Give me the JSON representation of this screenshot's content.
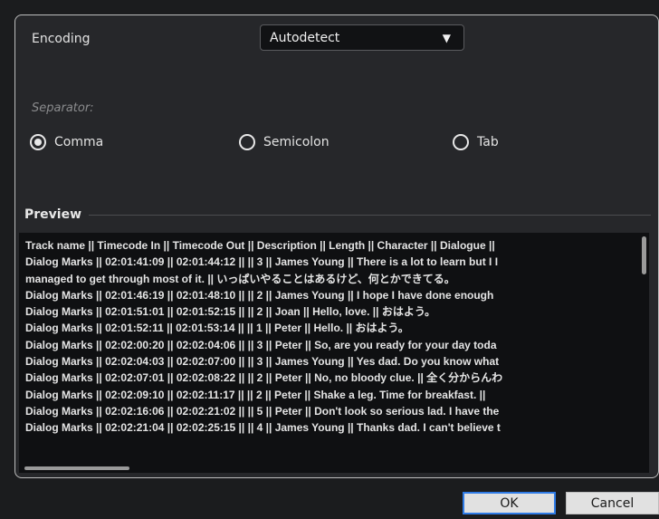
{
  "encoding": {
    "label": "Encoding",
    "value": "Autodetect"
  },
  "separator": {
    "label": "Separator:",
    "options": [
      {
        "label": "Comma",
        "selected": true
      },
      {
        "label": "Semicolon",
        "selected": false
      },
      {
        "label": "Tab",
        "selected": false
      }
    ]
  },
  "preview": {
    "title": "Preview",
    "lines": [
      "Track name  ||  Timecode In  ||  Timecode Out  ||  Description  ||  Length  ||  Character  ||  Dialogue  ||",
      "Dialog Marks  ||  02:01:41:09  ||  02:01:44:12  ||    ||  3  ||  James Young  ||  There is a lot to learn but I I",
      " managed to get through most of it.  ||  いっぱいやることはあるけど、何とかできてる。",
      "Dialog Marks  ||  02:01:46:19  ||  02:01:48:10  ||    ||  2  ||  James Young  ||  I hope I have done enough",
      "Dialog Marks  ||  02:01:51:01  ||  02:01:52:15  ||    ||  2  ||  Joan  ||  Hello, love.  ||  おはよう。",
      "Dialog Marks  ||  02:01:52:11  ||  02:01:53:14  ||    ||  1  ||  Peter  ||  Hello.  ||  おはよう。",
      "Dialog Marks  ||  02:02:00:20  ||  02:02:04:06  ||    ||  3  ||  Peter  ||  So, are you ready for your day toda",
      "Dialog Marks  ||  02:02:04:03  ||  02:02:07:00  ||    ||  3  ||  James Young  ||  Yes dad. Do you know what",
      "Dialog Marks  ||  02:02:07:01  ||  02:02:08:22  ||    ||  2  ||  Peter  ||  No, no bloody clue.  ||  全く分からんわ",
      "Dialog Marks  ||  02:02:09:10  ||  02:02:11:17  ||    ||  2  ||  Peter  ||  Shake a leg. Time for breakfast.  ||",
      "Dialog Marks  ||  02:02:16:06  ||  02:02:21:02  ||    ||  5  ||  Peter  ||  Don't look so serious lad. I have the",
      "Dialog Marks  ||  02:02:21:04  ||  02:02:25:15  ||    ||  4  ||  James Young  ||  Thanks dad. I can't believe t"
    ]
  },
  "buttons": {
    "ok": "OK",
    "cancel": "Cancel"
  }
}
